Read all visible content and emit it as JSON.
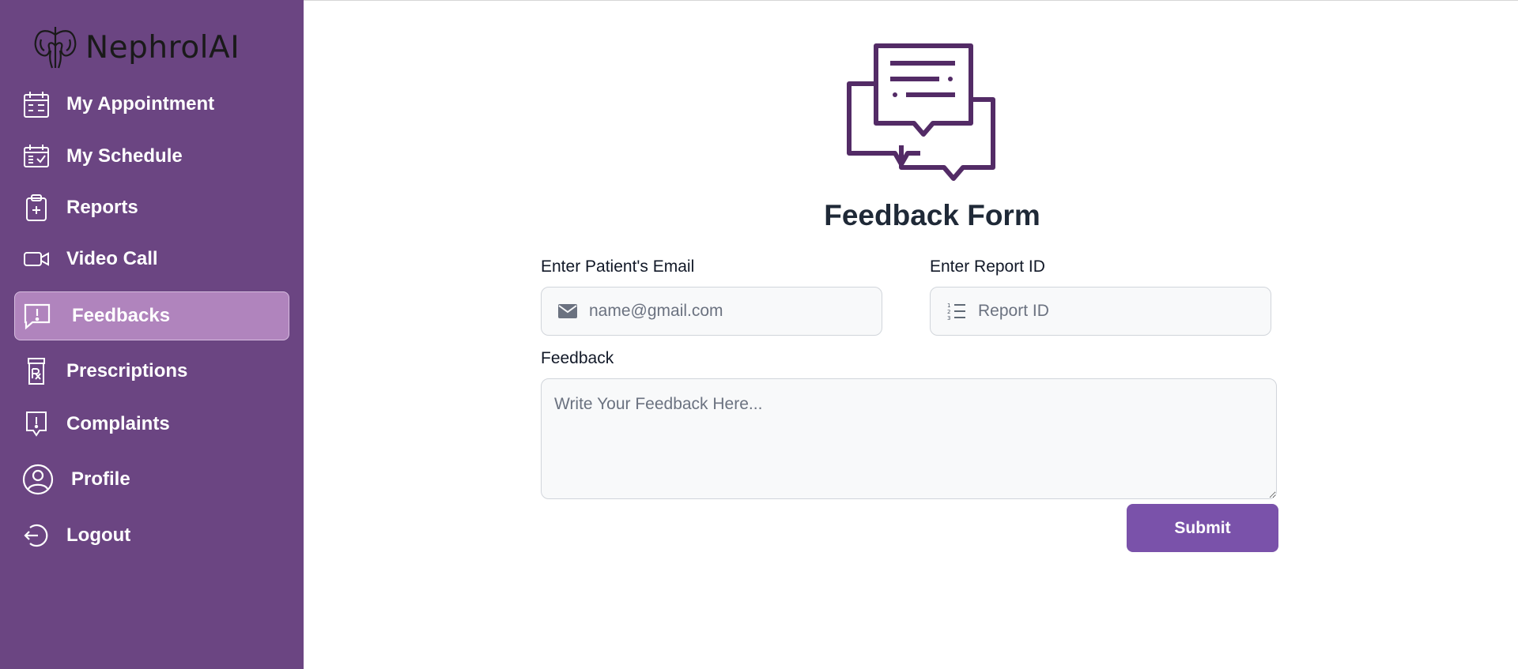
{
  "app": {
    "name": "NephrolAI"
  },
  "sidebar": {
    "items": [
      {
        "label": "My Appointment",
        "icon": "calendar-icon"
      },
      {
        "label": "My Schedule",
        "icon": "schedule-icon"
      },
      {
        "label": "Reports",
        "icon": "clipboard-plus-icon"
      },
      {
        "label": "Video Call",
        "icon": "video-camera-icon"
      },
      {
        "label": "Feedbacks",
        "icon": "chat-alert-icon",
        "active": true
      },
      {
        "label": "Prescriptions",
        "icon": "prescription-bottle-icon"
      },
      {
        "label": "Complaints",
        "icon": "complaint-icon"
      },
      {
        "label": "Profile",
        "icon": "user-circle-icon"
      },
      {
        "label": "Logout",
        "icon": "logout-icon"
      }
    ]
  },
  "form": {
    "title": "Feedback Form",
    "email": {
      "label": "Enter Patient's Email",
      "placeholder": "name@gmail.com",
      "value": ""
    },
    "report": {
      "label": "Enter Report ID",
      "placeholder": "Report ID",
      "value": ""
    },
    "feedback": {
      "label": "Feedback",
      "placeholder": "Write Your Feedback Here...",
      "value": ""
    },
    "submit_label": "Submit"
  },
  "colors": {
    "sidebar_bg": "#6b4582",
    "sidebar_active_bg": "#b084bd",
    "accent": "#7a52aa",
    "hero_icon": "#532b66"
  }
}
